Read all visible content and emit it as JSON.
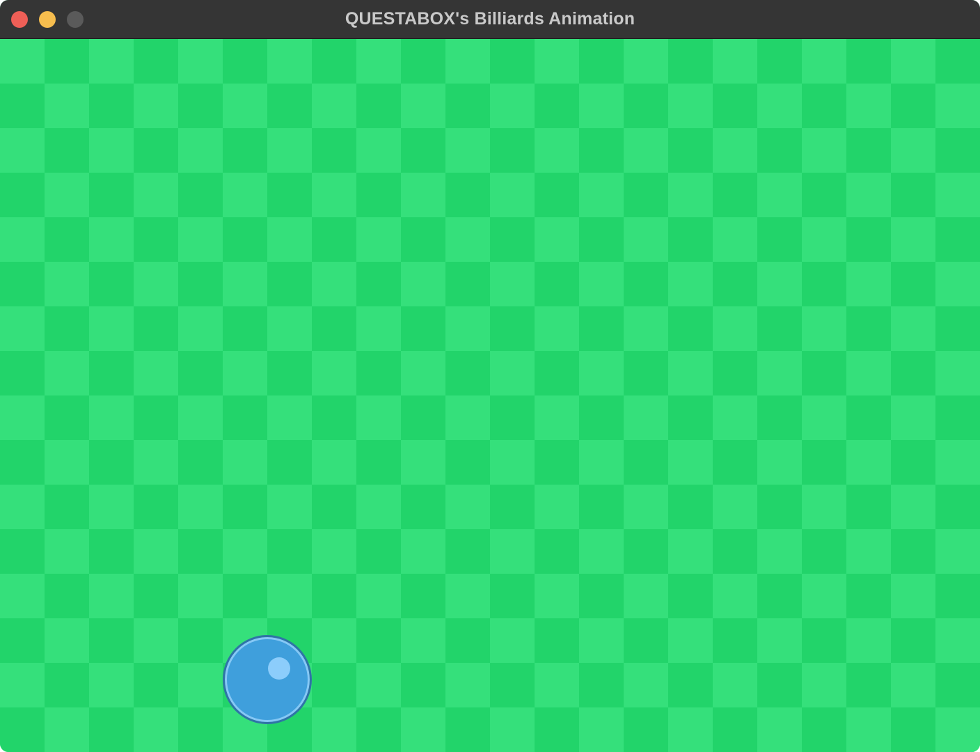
{
  "window": {
    "title": "QUESTABOX's Billiards Animation"
  },
  "controls": {
    "close_color": "#ee5f57",
    "minimize_color": "#f6bd4e",
    "zoom_color": "#5a5a5a"
  },
  "table": {
    "checker_light": "#35e07b",
    "checker_dark": "#22d46a"
  },
  "ball": {
    "color": "#3f9fdc",
    "highlight_color": "#8ccdfb",
    "outline_color": "#2f74a6"
  }
}
